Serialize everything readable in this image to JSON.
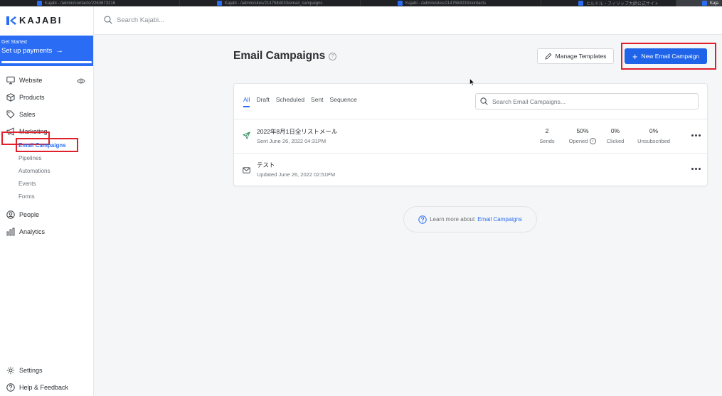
{
  "browser_tabs": [
    {
      "label": "Kajabi - /admin/contacts/2263673216",
      "width": 253,
      "active": false
    },
    {
      "label": "Kajabi - /admin/sites/2147584033/email_campaigns",
      "width": 254,
      "active": false
    },
    {
      "label": "Kajabi - /admin/sites/2147584033/contacts",
      "width": 254,
      "active": false
    },
    {
      "label": "ヒルドル・フィリップ大師公式サイト",
      "width": 190,
      "active": false
    },
    {
      "label": "Kaja",
      "width": 64,
      "active": true
    }
  ],
  "brand": {
    "name": "KAJABI",
    "accent": "#2a6df4"
  },
  "get_started": {
    "title": "Get Started",
    "action": "Set up payments",
    "progress": 1.0
  },
  "search": {
    "placeholder": "Search Kajabi..."
  },
  "nav": {
    "website": "Website",
    "products": "Products",
    "sales": "Sales",
    "marketing": "Marketing",
    "marketing_sub": [
      "Email Campaigns",
      "Pipelines",
      "Automations",
      "Events",
      "Forms"
    ],
    "people": "People",
    "analytics": "Analytics",
    "settings": "Settings",
    "help": "Help & Feedback"
  },
  "page": {
    "title": "Email Campaigns",
    "manage_templates": "Manage Templates",
    "new_campaign": "New Email Campaign"
  },
  "filters": {
    "tabs": [
      "All",
      "Draft",
      "Scheduled",
      "Sent",
      "Sequence"
    ],
    "active": "All",
    "search_placeholder": "Search Email Campaigns..."
  },
  "campaigns": [
    {
      "name": "2022年8月1日全リストメール",
      "meta": "Sent June 26, 2022 04:31PM",
      "status_icon": "send-icon",
      "stats": [
        {
          "value": "2",
          "label": "Sends"
        },
        {
          "value": "50%",
          "label": "Opened"
        },
        {
          "value": "0%",
          "label": "Clicked"
        },
        {
          "value": "0%",
          "label": "Unsubscribed"
        }
      ]
    },
    {
      "name": "テスト",
      "meta": "Updated June 26, 2022 02:51PM",
      "status_icon": "envelope-icon",
      "stats": []
    }
  ],
  "learn_more": {
    "text": "Learn more about",
    "link": "Email Campaigns"
  }
}
